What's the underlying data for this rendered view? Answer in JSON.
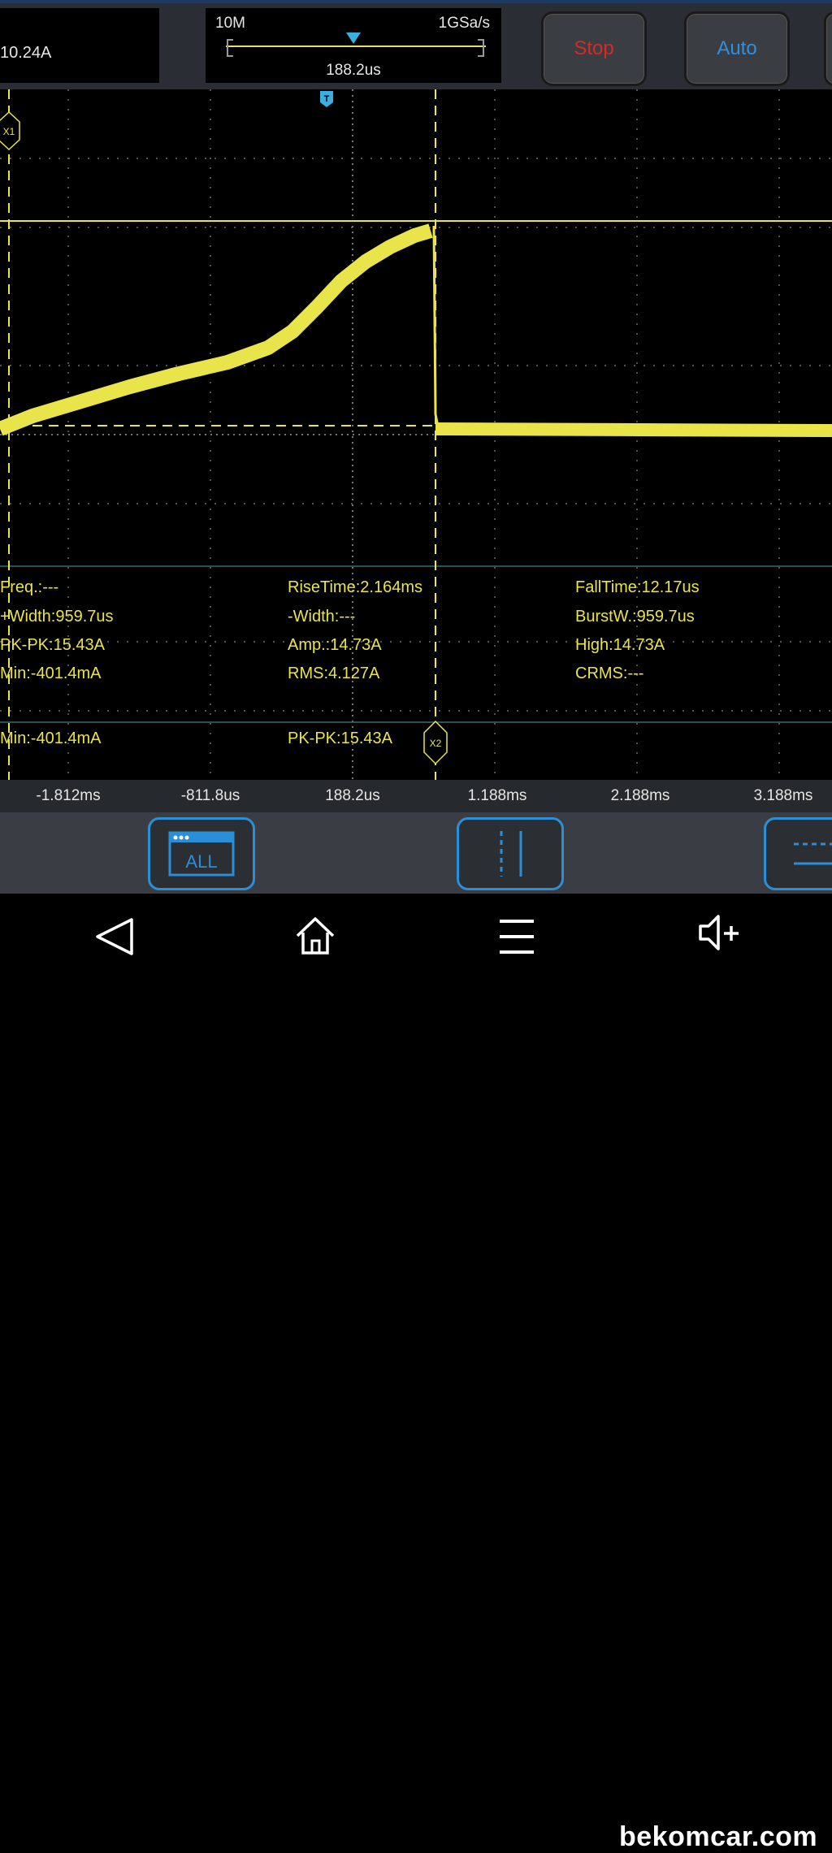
{
  "header": {
    "trigger_level": "10.24A",
    "timebase": {
      "memory_depth": "10M",
      "sample_rate": "1GSa/s",
      "position": "188.2us"
    },
    "buttons": {
      "stop": "Stop",
      "auto": "Auto"
    }
  },
  "colors": {
    "trace": "#e8e44a",
    "stop": "#d42a2a",
    "auto": "#2f8fe0",
    "accent": "#2a8fd6",
    "panel": "#2a2d33"
  },
  "screen": {
    "cursor_labels": {
      "x1": "X1",
      "x2": "X2",
      "trigger": "T"
    }
  },
  "measurements": {
    "col1": [
      "Freq.:---",
      "+Width:959.7us",
      "PK-PK:15.43A",
      "Min:-401.4mA"
    ],
    "col2": [
      "RiseTime:2.164ms",
      "-Width:---",
      "Amp.:14.73A",
      "RMS:4.127A"
    ],
    "col3": [
      "FallTime:12.17us",
      "BurstW.:959.7us",
      "High:14.73A",
      "CRMS:---"
    ],
    "cursor_row": [
      "Min:-401.4mA",
      "PK-PK:15.43A"
    ]
  },
  "x_axis": {
    "labels": [
      "-1.812ms",
      "-811.8us",
      "188.2us",
      "1.188ms",
      "2.188ms",
      "3.188ms"
    ]
  },
  "toolbar": {
    "all_label": "ALL"
  },
  "navbar": {
    "icons": [
      "back-icon",
      "home-icon",
      "menu-icon",
      "volume-up-icon"
    ]
  },
  "watermark": "bekomcar.com"
}
